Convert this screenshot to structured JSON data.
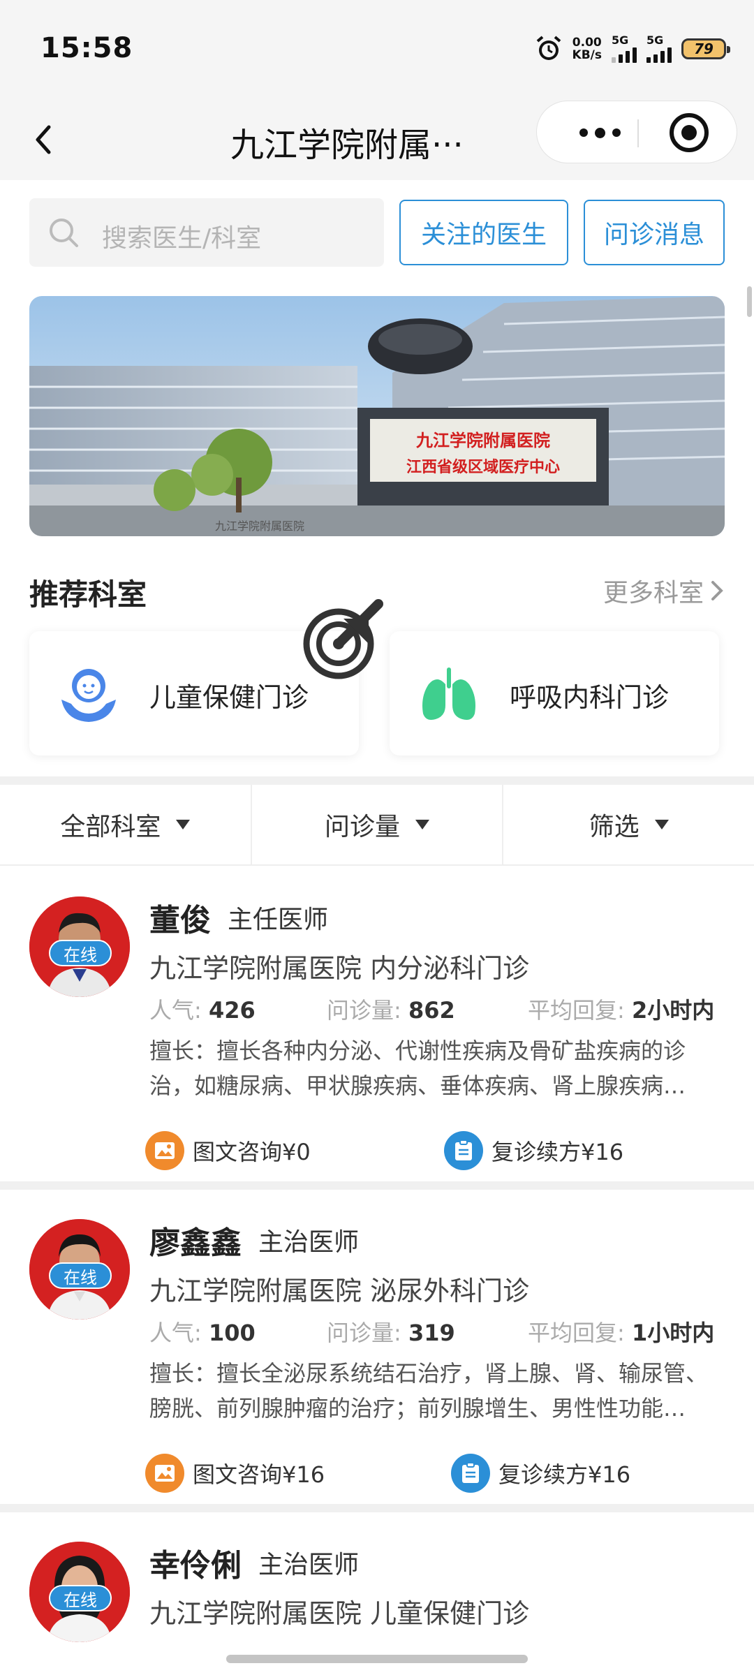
{
  "status_bar": {
    "time": "15:58",
    "net_speed_value": "0.00",
    "net_speed_unit": "KB/s",
    "signal1_label": "5G",
    "signal2_label": "5G",
    "battery": "79"
  },
  "title_bar": {
    "title": "九江学院附属···"
  },
  "search": {
    "placeholder": "搜索医生/科室"
  },
  "top_buttons": {
    "followed_doctors": "关注的医生",
    "consult_messages": "问诊消息"
  },
  "banner": {
    "sign_line1": "九江学院附属医院",
    "sign_line2": "江西省级区域医疗中心",
    "facade_text": "九江学院附属医院"
  },
  "recommended": {
    "title": "推荐科室",
    "more": "更多科室",
    "departments": [
      {
        "label": "儿童保健门诊",
        "icon": "child-care-icon"
      },
      {
        "label": "呼吸内科门诊",
        "icon": "lungs-icon"
      }
    ]
  },
  "filters": {
    "department": "全部科室",
    "consult_count": "问诊量",
    "filter": "筛选"
  },
  "doctors": [
    {
      "name": "董俊",
      "title": "主任医师",
      "online": "在线",
      "hospital": "九江学院附属医院 内分泌科门诊",
      "popularity_label": "人气:",
      "popularity": "426",
      "consults_label": "问诊量:",
      "consults": "862",
      "reply_label": "平均回复:",
      "reply": "2小时内",
      "expertise": "擅长：擅长各种内分泌、代谢性疾病及骨矿盐疾病的诊治，如糖尿病、甲状腺疾病、垂体疾病、肾上腺疾病…",
      "service1": "图文咨询¥0",
      "service2": "复诊续方¥16"
    },
    {
      "name": "廖鑫鑫",
      "title": "主治医师",
      "online": "在线",
      "hospital": "九江学院附属医院 泌尿外科门诊",
      "popularity_label": "人气:",
      "popularity": "100",
      "consults_label": "问诊量:",
      "consults": "319",
      "reply_label": "平均回复:",
      "reply": "1小时内",
      "expertise": "擅长：擅长全泌尿系统结石治疗，肾上腺、肾、输尿管、膀胱、前列腺肿瘤的治疗；前列腺增生、男性性功能…",
      "service1": "图文咨询¥16",
      "service2": "复诊续方¥16"
    },
    {
      "name": "幸伶俐",
      "title": "主治医师",
      "online": "在线",
      "hospital": "九江学院附属医院 儿童保健门诊"
    }
  ],
  "colors": {
    "accent": "#2b8fd7",
    "online_badge": "#2b8fd7",
    "avatar_bg": "#d42121",
    "image_consult_icon": "#f08a2c",
    "renewal_icon": "#2b8fd7",
    "lungs_icon": "#3fcf8e"
  }
}
